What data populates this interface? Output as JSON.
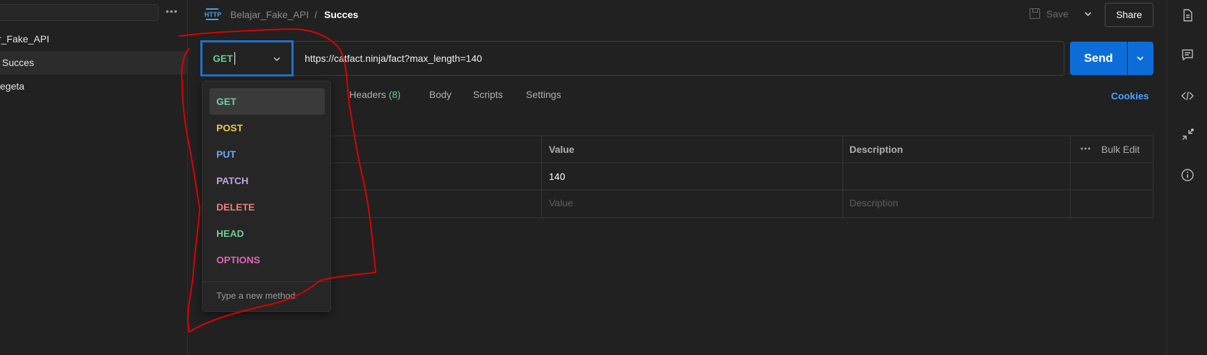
{
  "sidebar": {
    "more_glyph": "•••",
    "items": [
      {
        "label": "r_Fake_API",
        "active": false
      },
      {
        "label": "Succes",
        "active": true
      },
      {
        "label": "egeta",
        "active": false
      }
    ]
  },
  "header": {
    "collection": "Belajar_Fake_API",
    "separator": "/",
    "request_name": "Succes",
    "icon_text": "HTTP",
    "save_label": "Save",
    "share_label": "Share"
  },
  "request": {
    "method": "GET",
    "url": "https://catfact.ninja/fact?max_length=140",
    "send_label": "Send"
  },
  "tabs": [
    {
      "label": "Headers",
      "count": "(8)"
    },
    {
      "label": "Body"
    },
    {
      "label": "Scripts"
    },
    {
      "label": "Settings"
    }
  ],
  "cookies_label": "Cookies",
  "params_table": {
    "headers": [
      "Value",
      "Description"
    ],
    "bulk_more": "•••",
    "bulk_edit": "Bulk Edit",
    "rows": [
      {
        "value": "140",
        "description": ""
      }
    ],
    "placeholder": {
      "value": "Value",
      "description": "Description"
    }
  },
  "method_dropdown": {
    "items": [
      {
        "label": "GET",
        "color": "#6fcf97",
        "selected": true
      },
      {
        "label": "POST",
        "color": "#f2c94c",
        "selected": false
      },
      {
        "label": "PUT",
        "color": "#6ea8fe",
        "selected": false
      },
      {
        "label": "PATCH",
        "color": "#c3a6e0",
        "selected": false
      },
      {
        "label": "DELETE",
        "color": "#f07f7f",
        "selected": false
      },
      {
        "label": "HEAD",
        "color": "#6fcf97",
        "selected": false
      },
      {
        "label": "OPTIONS",
        "color": "#e366b8",
        "selected": false
      }
    ],
    "new_method": "Type a new method"
  },
  "colors": {
    "accent": "#0d6dd8",
    "annotation": "#e00000",
    "focus_border": "#1e72d2"
  },
  "icons": [
    "http-icon",
    "save-icon",
    "chevron-down-icon",
    "document-icon",
    "comment-icon",
    "code-icon",
    "collapse-icon",
    "info-icon"
  ]
}
